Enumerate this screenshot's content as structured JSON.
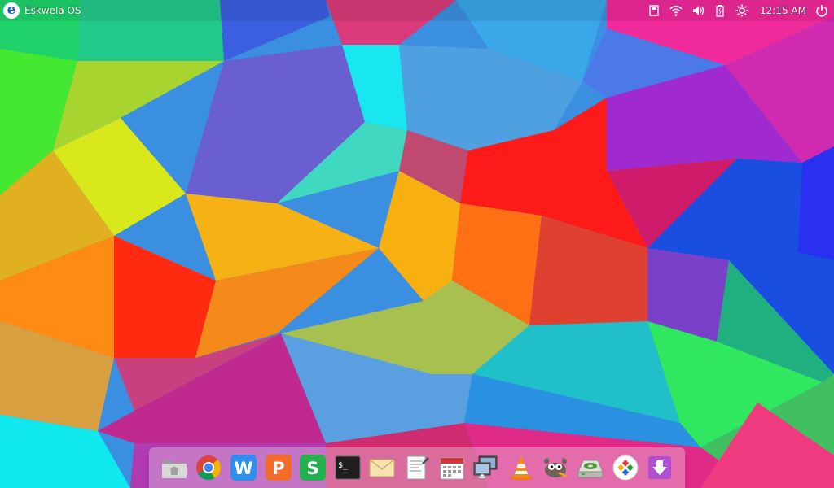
{
  "top_panel": {
    "os_logo_letter": "e",
    "os_name": "Eskwela OS",
    "tray": [
      "storage-icon",
      "wifi-icon",
      "volume-icon",
      "battery-icon",
      "brightness-icon"
    ],
    "clock": "12:15 AM",
    "power_icon": "power-icon"
  },
  "dock": {
    "items": [
      {
        "name": "home-folder",
        "icon": "folder-home-icon"
      },
      {
        "name": "chrome",
        "icon": "chrome-icon"
      },
      {
        "name": "wps-writer",
        "icon": "wps-writer-icon",
        "letter": "W"
      },
      {
        "name": "wps-presentation",
        "icon": "wps-presentation-icon",
        "letter": "P"
      },
      {
        "name": "wps-spreadsheets",
        "icon": "wps-spreadsheets-icon",
        "letter": "S"
      },
      {
        "name": "terminal",
        "icon": "terminal-icon",
        "text": "$_"
      },
      {
        "name": "mail",
        "icon": "mail-icon"
      },
      {
        "name": "text-editor",
        "icon": "text-editor-icon"
      },
      {
        "name": "calendar",
        "icon": "calendar-icon"
      },
      {
        "name": "remote-desktop",
        "icon": "remote-desktop-icon"
      },
      {
        "name": "vlc",
        "icon": "vlc-icon"
      },
      {
        "name": "gimp",
        "icon": "gimp-icon"
      },
      {
        "name": "disk-utility",
        "icon": "disk-utility-icon"
      },
      {
        "name": "software-center",
        "icon": "software-center-icon"
      },
      {
        "name": "downloads",
        "icon": "download-icon"
      }
    ]
  },
  "colors": {
    "wps_writer": "#2d8ff0",
    "wps_presentation": "#f26b2a",
    "wps_spreadsheets": "#22b14c",
    "download": "#b04fd0"
  }
}
